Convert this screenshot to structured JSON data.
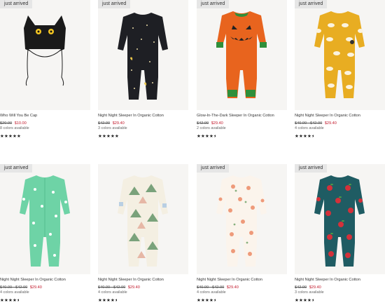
{
  "products": [
    {
      "badge": "just arrived",
      "name": "Who Will You Be Cap",
      "was_price": "$20.00",
      "price": "$10.00",
      "colors": "8 colors available",
      "rating": 5,
      "image_icon": "cat-cap-image"
    },
    {
      "badge": "just arrived",
      "name": "Night Night Sleeper In Organic Cotton",
      "was_price": "$42.00",
      "price": "$29.40",
      "colors": "3 colors available",
      "rating": 5,
      "image_icon": "black-star-sleeper-image"
    },
    {
      "badge": "just arrived",
      "name": "Glow-In-The-Dark Sleeper In Organic Cotton",
      "was_price": "$42.00",
      "price": "$29.40",
      "colors": "2 colors available",
      "rating": 4.5,
      "image_icon": "pumpkin-sleeper-image"
    },
    {
      "badge": "just arrived",
      "name": "Night Night Sleeper In Organic Cotton",
      "was_price": "$40.00 - $42.00",
      "price": "$29.40",
      "colors": "4 colors available",
      "rating": 4.5,
      "image_icon": "yellow-sheep-sleeper-image"
    },
    {
      "badge": "just arrived",
      "name": "Night Night Sleeper In Organic Cotton",
      "was_price": "$40.00 - $42.00",
      "price": "$29.40",
      "colors": "4 colors available",
      "rating": 4.5,
      "image_icon": "green-bunny-sleeper-image"
    },
    {
      "badge": "",
      "name": "Night Night Sleeper In Organic Cotton",
      "was_price": "$40.00 - $42.00",
      "price": "$29.40",
      "colors": "4 colors available",
      "rating": 4.5,
      "image_icon": "mountain-sleeper-image"
    },
    {
      "badge": "just arrived",
      "name": "Night Night Sleeper In Organic Cotton",
      "was_price": "$40.00 - $42.00",
      "price": "$29.40",
      "colors": "4 colors available",
      "rating": 4.5,
      "image_icon": "floral-sleeper-image"
    },
    {
      "badge": "just arrived",
      "name": "Night Night Sleeper In Organic Cotton",
      "was_price": "$42.00",
      "price": "$29.40",
      "colors": "3 colors available",
      "rating": 4.5,
      "image_icon": "apple-sleeper-image"
    }
  ],
  "colors": {
    "sale_price": "#c2192b",
    "badge_bg": "#e6e6e6",
    "image_bg": "#f6f5f3"
  }
}
